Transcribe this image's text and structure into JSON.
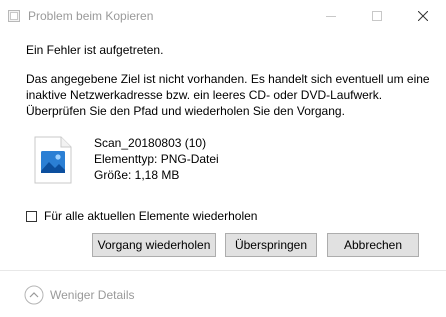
{
  "window": {
    "title": "Problem beim Kopieren",
    "minimize_icon": "minimize-icon",
    "maximize_icon": "maximize-icon",
    "close_icon": "close-icon"
  },
  "heading": "Ein Fehler ist aufgetreten.",
  "message": {
    "line1": "Das angegebene Ziel ist nicht vorhanden. Es handelt sich eventuell um eine",
    "line2": "inaktive Netzwerkadresse bzw. ein leeres CD- oder DVD-Laufwerk.",
    "line3": "Überprüfen Sie den Pfad und wiederholen Sie den Vorgang."
  },
  "file": {
    "icon": "image-file-icon",
    "name": "Scan_20180803 (10)",
    "type": "Elementtyp: PNG-Datei",
    "size": "Größe: 1,18 MB"
  },
  "repeat_checkbox": {
    "label": "Für alle aktuellen Elemente wiederholen",
    "checked": false
  },
  "buttons": {
    "retry": "Vorgang wiederholen",
    "skip": "Überspringen",
    "cancel": "Abbrechen"
  },
  "details_toggle": {
    "label": "Weniger Details",
    "icon": "chevron-up-circle-icon"
  },
  "colors": {
    "file_icon_blue": "#2b7fd4",
    "disabled_text": "#9a9a9a",
    "button_face": "#e1e1e1"
  }
}
